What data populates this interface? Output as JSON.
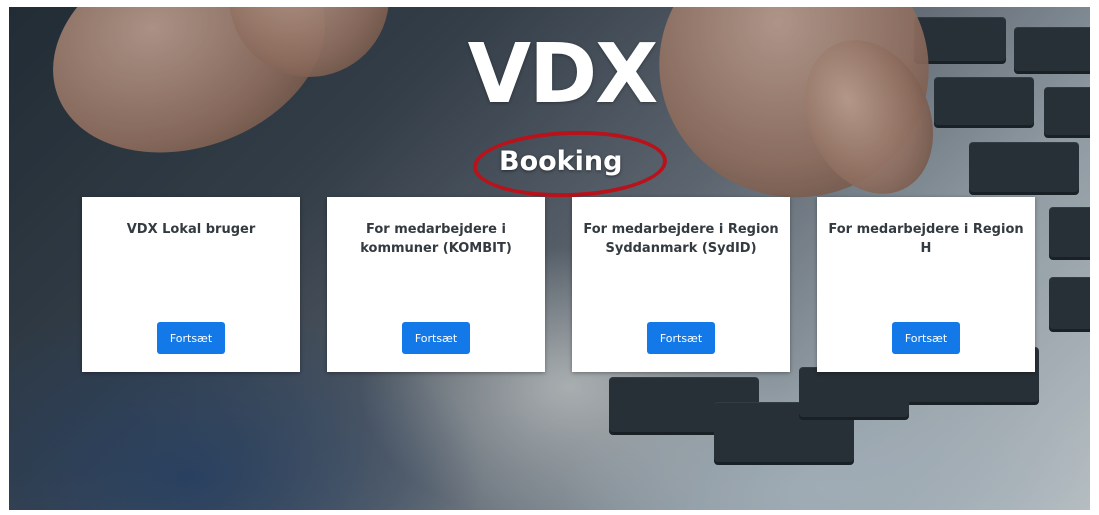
{
  "brand": {
    "logo_text": "VDX"
  },
  "page": {
    "heading": "Booking"
  },
  "login_options": [
    {
      "title": "VDX Lokal bruger",
      "button_label": "Fortsæt"
    },
    {
      "title": "For medarbejdere i kommuner (KOMBIT)",
      "button_label": "Fortsæt"
    },
    {
      "title": "For medarbejdere i Region Syddanmark (SydID)",
      "button_label": "Fortsæt"
    },
    {
      "title": "For medarbejdere i Region H",
      "button_label": "Fortsæt"
    }
  ],
  "colors": {
    "button": "#1479e8",
    "highlight": "#b8121b"
  }
}
